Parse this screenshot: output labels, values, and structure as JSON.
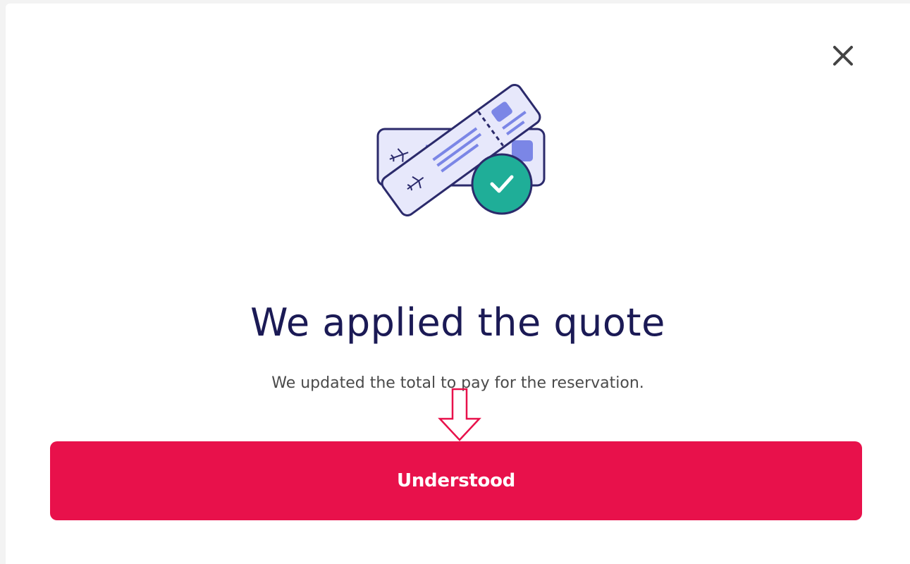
{
  "dialog": {
    "title": "We applied the quote",
    "message": "We updated the total to pay for the reservation.",
    "primary_button_label": "Understood",
    "close_icon": "close-icon",
    "illustration_icon": "tickets-confirmed-illustration",
    "hint_icon": "arrow-down-hint-icon"
  },
  "colors": {
    "accent": "#e8114b",
    "title_text": "#1b1a55",
    "body_text": "#4a4a4a",
    "ticket_fill": "#e7e8fb",
    "ticket_detail": "#7b86e6",
    "ticket_outline": "#2b2a6b",
    "check_badge": "#1fae98"
  }
}
